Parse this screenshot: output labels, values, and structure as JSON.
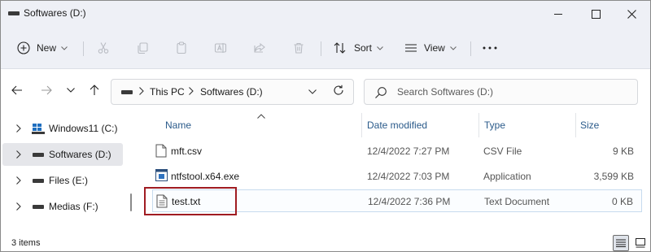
{
  "window": {
    "title": "Softwares (D:)"
  },
  "commandbar": {
    "new_label": "New",
    "sort_label": "Sort",
    "view_label": "View"
  },
  "address": {
    "segments": [
      "This PC",
      "Softwares (D:)"
    ]
  },
  "search": {
    "placeholder": "Search Softwares (D:)"
  },
  "sidebar": {
    "items": [
      {
        "label": "Windows11 (C:)",
        "icon": "windows-drive-icon"
      },
      {
        "label": "Softwares (D:)",
        "icon": "drive-icon",
        "selected": true
      },
      {
        "label": "Files (E:)",
        "icon": "drive-icon"
      },
      {
        "label": "Medias (F:)",
        "icon": "drive-icon"
      }
    ]
  },
  "columns": {
    "name": "Name",
    "date": "Date modified",
    "type": "Type",
    "size": "Size"
  },
  "files": [
    {
      "name": "mft.csv",
      "date": "12/4/2022 7:27 PM",
      "type": "CSV File",
      "size": "9 KB",
      "icon": "csv-file-icon"
    },
    {
      "name": "ntfstool.x64.exe",
      "date": "12/4/2022 7:03 PM",
      "type": "Application",
      "size": "3,599 KB",
      "icon": "exe-file-icon"
    },
    {
      "name": "test.txt",
      "date": "12/4/2022 7:36 PM",
      "type": "Text Document",
      "size": "0 KB",
      "icon": "text-file-icon",
      "selected": true
    }
  ],
  "status": {
    "count": "3 items"
  },
  "colors": {
    "chrome": "#eef0f6",
    "header_text": "#2a5a8a",
    "highlight": "#a01c22",
    "selection": "#e5e6ea"
  }
}
